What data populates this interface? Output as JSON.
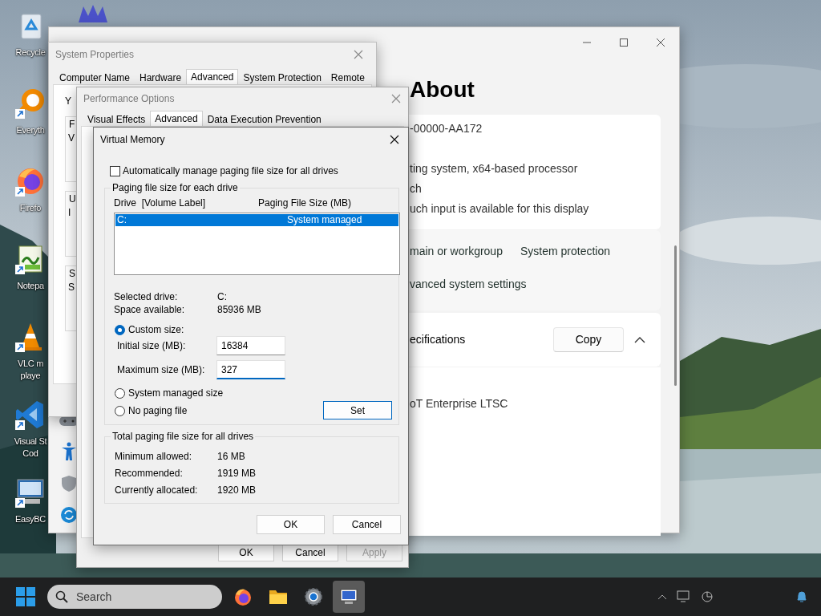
{
  "desktop_icons": [
    {
      "kind": "recycle",
      "label_lines": [
        "Recycle"
      ]
    },
    {
      "kind": "everything",
      "label_lines": [
        "Everyth"
      ]
    },
    {
      "kind": "firefox",
      "label_lines": [
        "Firefo"
      ]
    },
    {
      "kind": "notepad",
      "label_lines": [
        "Notepa"
      ]
    },
    {
      "kind": "vlc",
      "label_lines": [
        "VLC m",
        "playe"
      ]
    },
    {
      "kind": "vscode",
      "label_lines": [
        "Visual St",
        "Cod"
      ]
    },
    {
      "kind": "easybcd",
      "label_lines": [
        "EasyBC"
      ]
    }
  ],
  "settings_window": {
    "heading": "About",
    "device_lines": [
      "-00000-AA172",
      "ting system, x64-based processor",
      "ch",
      "uch input is available for this display"
    ],
    "related_links": [
      {
        "links": [
          "main or workgroup",
          "System protection"
        ]
      },
      {
        "links": [
          "vanced system settings"
        ]
      }
    ],
    "spec_title": "ecifications",
    "copy_button": "Copy",
    "spec_expanded": true,
    "spec_lines": [
      "oT Enterprise LTSC"
    ]
  },
  "system_properties": {
    "title": "System Properties",
    "tabs": [
      {
        "label": "Computer Name",
        "selected": false
      },
      {
        "label": "Hardware",
        "selected": false
      },
      {
        "label": "Advanced",
        "selected": true
      },
      {
        "label": "System Protection",
        "selected": false
      },
      {
        "label": "Remote",
        "selected": false
      }
    ],
    "intro": "Y",
    "groups": [
      {
        "lines": [
          "F",
          "V"
        ]
      },
      {
        "lines": [
          "U",
          "I"
        ]
      },
      {
        "lines": [
          "S",
          "S"
        ]
      }
    ]
  },
  "performance_options": {
    "title": "Performance Options",
    "tabs": [
      {
        "label": "Visual Effects",
        "selected": false
      },
      {
        "label": "Advanced",
        "selected": true
      },
      {
        "label": "Data Execution Prevention",
        "selected": false
      }
    ],
    "buttons": [
      {
        "label": "OK",
        "disabled": false
      },
      {
        "label": "Cancel",
        "disabled": false
      },
      {
        "label": "Apply",
        "disabled": true
      }
    ]
  },
  "virtual_memory": {
    "title": "Virtual Memory",
    "auto_manage": {
      "label": "Automatically manage paging file size for all drives",
      "checked": false
    },
    "drives_group": "Paging file size for each drive",
    "columns": [
      "Drive  [Volume Label]",
      "Paging File Size (MB)"
    ],
    "drives": [
      {
        "drive": "C:",
        "size": "System managed",
        "selected": true
      }
    ],
    "info": [
      {
        "label": "Selected drive:",
        "value": "C:"
      },
      {
        "label": "Space available:",
        "value": "85936 MB"
      }
    ],
    "options": [
      {
        "label": "Custom size:",
        "selected": true
      },
      {
        "label": "System managed size",
        "selected": false
      },
      {
        "label": "No paging file",
        "selected": false
      }
    ],
    "fields": [
      {
        "label": "Initial size (MB):",
        "value": "16384",
        "focused": false
      },
      {
        "label": "Maximum size (MB):",
        "value": "327",
        "focused": true
      }
    ],
    "set_button": "Set",
    "totals_group": "Total paging file size for all drives",
    "totals": [
      {
        "label": "Minimum allowed:",
        "value": "16 MB"
      },
      {
        "label": "Recommended:",
        "value": "1919 MB"
      },
      {
        "label": "Currently allocated:",
        "value": "1920 MB"
      }
    ],
    "buttons": [
      "OK",
      "Cancel"
    ]
  },
  "taskbar": {
    "search_placeholder": "Search",
    "apps": [
      {
        "kind": "firefox",
        "active": false
      },
      {
        "kind": "folder",
        "active": false
      },
      {
        "kind": "settings",
        "active": false
      },
      {
        "kind": "sysprops",
        "active": true
      }
    ]
  }
}
